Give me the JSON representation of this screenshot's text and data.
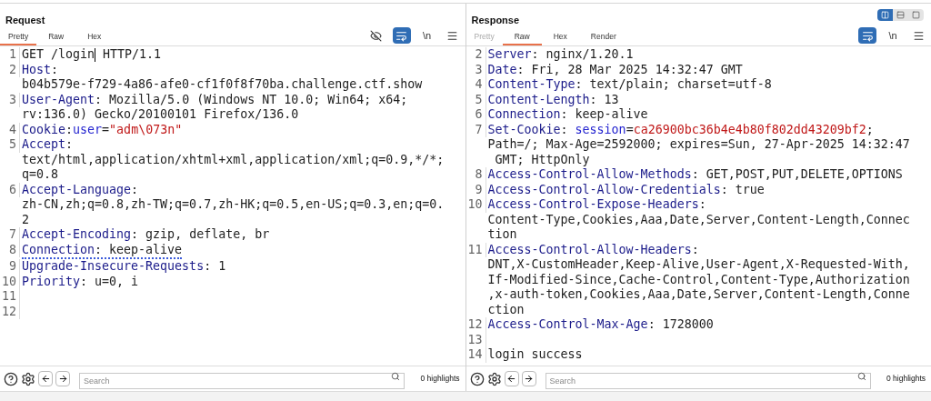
{
  "view_toggle": [
    {
      "kind": "split",
      "selected": true
    },
    {
      "kind": "stacked",
      "selected": false
    },
    {
      "kind": "single",
      "selected": false
    }
  ],
  "panels": [
    {
      "title": "Request",
      "tabs": [
        {
          "label": "Pretty",
          "selected": true,
          "disabled": false
        },
        {
          "label": "Raw",
          "selected": false,
          "disabled": false
        },
        {
          "label": "Hex",
          "selected": false,
          "disabled": false
        }
      ],
      "tools": [
        {
          "kind": "hide",
          "on": false
        },
        {
          "kind": "wrap",
          "on": true
        },
        {
          "kind": "newline",
          "label": "\\n",
          "on": false
        },
        {
          "kind": "menu",
          "on": false
        }
      ],
      "lines": [
        {
          "number": "1",
          "kind": "code",
          "rows": [
            [
              {
                "kind": "plain",
                "text": "GET /login"
              },
              {
                "kind": "caret"
              },
              {
                "kind": "plain",
                "text": " HTTP/1.1"
              }
            ]
          ]
        },
        {
          "number": "2",
          "kind": "code",
          "rows": [
            [
              {
                "kind": "key",
                "text": "Host"
              },
              {
                "kind": "plain",
                "text": ":"
              }
            ],
            [
              {
                "kind": "plain",
                "text": "b04b579e-f729-4a86-afe0-cf1f0f8f70ba.challenge.ctf.show"
              }
            ]
          ]
        },
        {
          "number": "3",
          "kind": "code",
          "rows": [
            [
              {
                "kind": "key",
                "text": "User-Agent"
              },
              {
                "kind": "plain",
                "text": ": Mozilla/5.0 (Windows NT 10.0; Win64; x64;"
              }
            ],
            [
              {
                "kind": "plain",
                "text": "rv:136.0) Gecko/20100101 Firefox/136.0"
              }
            ]
          ]
        },
        {
          "number": "4",
          "kind": "code",
          "rows": [
            [
              {
                "kind": "key",
                "text": "Cookie"
              },
              {
                "kind": "plain",
                "text": ":"
              },
              {
                "kind": "attr",
                "text": "user"
              },
              {
                "kind": "plain",
                "text": "="
              },
              {
                "kind": "string",
                "text": "\"adm\\073n\""
              }
            ]
          ]
        },
        {
          "number": "5",
          "kind": "code",
          "rows": [
            [
              {
                "kind": "key",
                "text": "Accept"
              },
              {
                "kind": "plain",
                "text": ":"
              }
            ],
            [
              {
                "kind": "plain",
                "text": "text/html,application/xhtml+xml,application/xml;q=0.9,*/*;"
              }
            ],
            [
              {
                "kind": "plain",
                "text": "q=0.8"
              }
            ]
          ]
        },
        {
          "number": "6",
          "kind": "code",
          "rows": [
            [
              {
                "kind": "key",
                "text": "Accept-Language"
              },
              {
                "kind": "plain",
                "text": ":"
              }
            ],
            [
              {
                "kind": "plain",
                "text": "zh-CN,zh;q=0.8,zh-TW;q=0.7,zh-HK;q=0.5,en-US;q=0.3,en;q=0."
              }
            ],
            [
              {
                "kind": "plain",
                "text": "2"
              }
            ]
          ]
        },
        {
          "number": "7",
          "kind": "code",
          "rows": [
            [
              {
                "kind": "key",
                "text": "Accept-Encoding"
              },
              {
                "kind": "plain",
                "text": ": gzip, deflate, br"
              }
            ]
          ]
        },
        {
          "number": "8",
          "kind": "flagged",
          "rows": [
            [
              {
                "kind": "key",
                "text": "Connection"
              },
              {
                "kind": "plain",
                "text": ": keep-alive"
              }
            ]
          ]
        },
        {
          "number": "9",
          "kind": "code",
          "rows": [
            [
              {
                "kind": "key",
                "text": "Upgrade-Insecure-Requests"
              },
              {
                "kind": "plain",
                "text": ": 1"
              }
            ]
          ]
        },
        {
          "number": "10",
          "kind": "code",
          "rows": [
            [
              {
                "kind": "key",
                "text": "Priority"
              },
              {
                "kind": "plain",
                "text": ": u=0, i"
              }
            ]
          ]
        },
        {
          "number": "11",
          "kind": "blank"
        },
        {
          "number": "12",
          "kind": "blank"
        }
      ],
      "footer": {
        "search_placeholder": "Search",
        "highlights": "0 highlights"
      }
    },
    {
      "title": "Response",
      "tabs": [
        {
          "label": "Pretty",
          "selected": false,
          "disabled": true
        },
        {
          "label": "Raw",
          "selected": true,
          "disabled": false
        },
        {
          "label": "Hex",
          "selected": false,
          "disabled": false
        },
        {
          "label": "Render",
          "selected": false,
          "disabled": false
        }
      ],
      "tools": [
        {
          "kind": "wrap",
          "on": true
        },
        {
          "kind": "newline",
          "label": "\\n",
          "on": false
        },
        {
          "kind": "menu",
          "on": false
        }
      ],
      "lines": [
        {
          "number": "2",
          "kind": "code",
          "rows": [
            [
              {
                "kind": "key",
                "text": "Server"
              },
              {
                "kind": "plain",
                "text": ": nginx/1.20.1"
              }
            ]
          ]
        },
        {
          "number": "3",
          "kind": "code",
          "rows": [
            [
              {
                "kind": "key",
                "text": "Date"
              },
              {
                "kind": "plain",
                "text": ": Fri, 28 Mar 2025 14:32:47 GMT"
              }
            ]
          ]
        },
        {
          "number": "4",
          "kind": "code",
          "rows": [
            [
              {
                "kind": "key",
                "text": "Content-Type"
              },
              {
                "kind": "plain",
                "text": ": text/plain; charset=utf-8"
              }
            ]
          ]
        },
        {
          "number": "5",
          "kind": "code",
          "rows": [
            [
              {
                "kind": "key",
                "text": "Content-Length"
              },
              {
                "kind": "plain",
                "text": ": 13"
              }
            ]
          ]
        },
        {
          "number": "6",
          "kind": "code",
          "rows": [
            [
              {
                "kind": "key",
                "text": "Connection"
              },
              {
                "kind": "plain",
                "text": ": keep-alive"
              }
            ]
          ]
        },
        {
          "number": "7",
          "kind": "code",
          "rows": [
            [
              {
                "kind": "key",
                "text": "Set-Cookie"
              },
              {
                "kind": "plain",
                "text": ": "
              },
              {
                "kind": "attr",
                "text": "session"
              },
              {
                "kind": "plain",
                "text": "="
              },
              {
                "kind": "string",
                "text": "ca26900bc36b4e4b80f802dd43209bf2"
              },
              {
                "kind": "plain",
                "text": ";"
              }
            ],
            [
              {
                "kind": "plain",
                "text": "Path=/; Max-Age=2592000; expires=Sun, 27-Apr-2025 14:32:47"
              }
            ],
            [
              {
                "kind": "plain",
                "text": " GMT; HttpOnly"
              }
            ]
          ]
        },
        {
          "number": "8",
          "kind": "code",
          "rows": [
            [
              {
                "kind": "key",
                "text": "Access-Control-Allow-Methods"
              },
              {
                "kind": "plain",
                "text": ": GET,POST,PUT,DELETE,OPTIONS"
              }
            ]
          ]
        },
        {
          "number": "9",
          "kind": "code",
          "rows": [
            [
              {
                "kind": "key",
                "text": "Access-Control-Allow-Credentials"
              },
              {
                "kind": "plain",
                "text": ": true"
              }
            ]
          ]
        },
        {
          "number": "10",
          "kind": "code",
          "rows": [
            [
              {
                "kind": "key",
                "text": "Access-Control-Expose-Headers"
              },
              {
                "kind": "plain",
                "text": ":"
              }
            ],
            [
              {
                "kind": "plain",
                "text": "Content-Type,Cookies,Aaa,Date,Server,Content-Length,Connec"
              }
            ],
            [
              {
                "kind": "plain",
                "text": "tion"
              }
            ]
          ]
        },
        {
          "number": "11",
          "kind": "code",
          "rows": [
            [
              {
                "kind": "key",
                "text": "Access-Control-Allow-Headers"
              },
              {
                "kind": "plain",
                "text": ":"
              }
            ],
            [
              {
                "kind": "plain",
                "text": "DNT,X-CustomHeader,Keep-Alive,User-Agent,X-Requested-With,"
              }
            ],
            [
              {
                "kind": "plain",
                "text": "If-Modified-Since,Cache-Control,Content-Type,Authorization"
              }
            ],
            [
              {
                "kind": "plain",
                "text": ",x-auth-token,Cookies,Aaa,Date,Server,Content-Length,Conne"
              }
            ],
            [
              {
                "kind": "plain",
                "text": "ction"
              }
            ]
          ]
        },
        {
          "number": "12",
          "kind": "code",
          "rows": [
            [
              {
                "kind": "key",
                "text": "Access-Control-Max-Age"
              },
              {
                "kind": "plain",
                "text": ": 1728000"
              }
            ]
          ]
        },
        {
          "number": "13",
          "kind": "blank"
        },
        {
          "number": "14",
          "kind": "code",
          "rows": [
            [
              {
                "kind": "plain",
                "text": "login success"
              }
            ]
          ]
        }
      ],
      "footer": {
        "search_placeholder": "Search",
        "highlights": "0 highlights"
      }
    }
  ]
}
